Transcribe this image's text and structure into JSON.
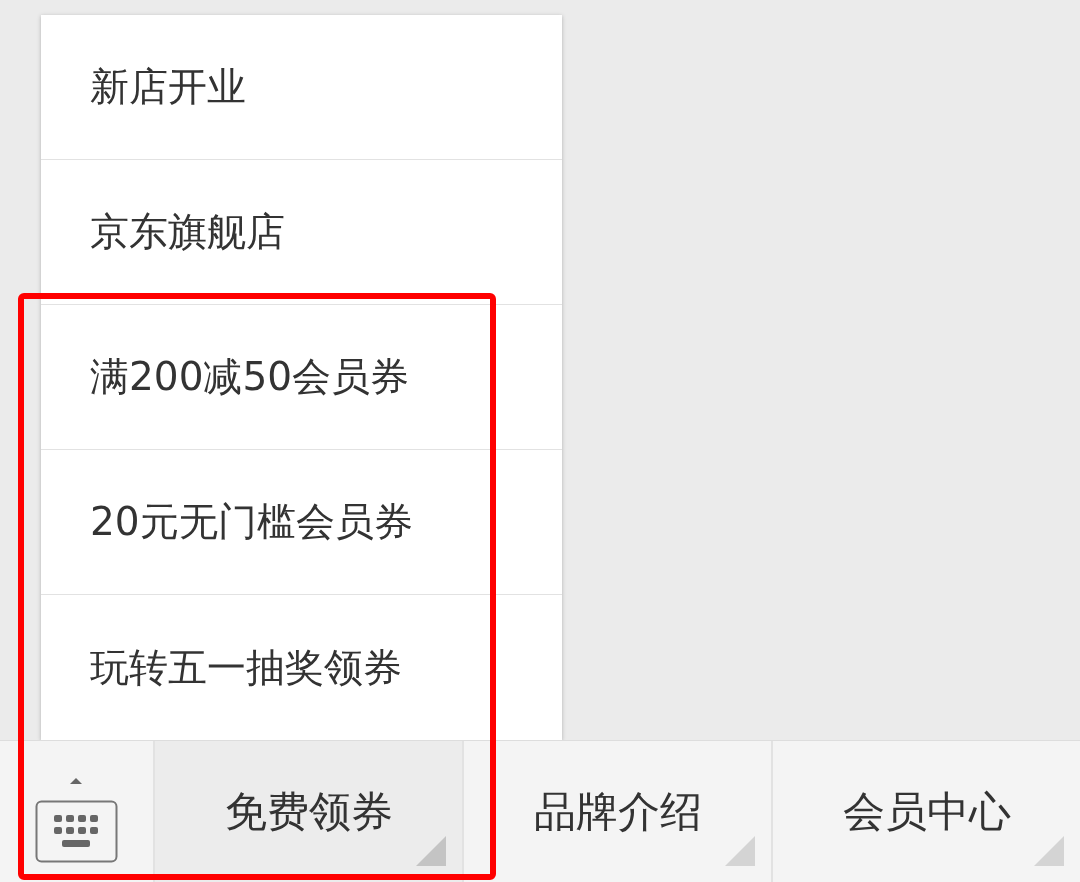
{
  "submenu": {
    "items": [
      {
        "label": "新店开业"
      },
      {
        "label": "京东旗舰店"
      },
      {
        "label": "满200减50会员券"
      },
      {
        "label": "20元无门槛会员券"
      },
      {
        "label": "玩转五一抽奖领券"
      }
    ]
  },
  "menu_bar": {
    "items": [
      {
        "label": "免费领券",
        "expanded": true
      },
      {
        "label": "品牌介绍",
        "expanded": false
      },
      {
        "label": "会员中心",
        "expanded": false
      }
    ]
  }
}
